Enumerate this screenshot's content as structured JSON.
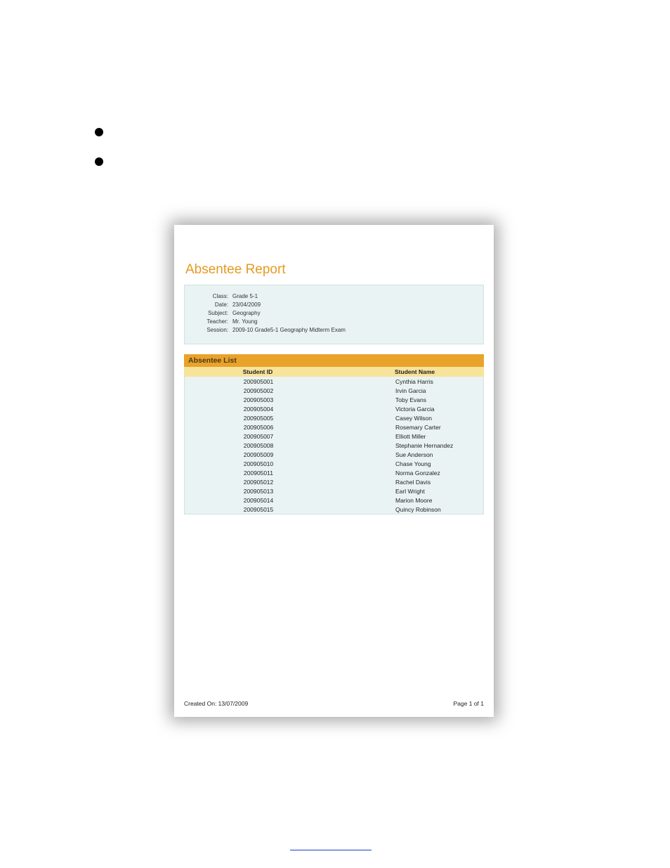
{
  "report": {
    "title": "Absentee Report",
    "info": {
      "class_label": "Class:",
      "class_value": "Grade 5-1",
      "date_label": "Date:",
      "date_value": "23/04/2009",
      "subject_label": "Subject:",
      "subject_value": "Geography",
      "teacher_label": "Teacher:",
      "teacher_value": "Mr. Young",
      "session_label": "Session:",
      "session_value": "2009-10 Grade5-1 Geography Midterm Exam"
    },
    "list_section_title": "Absentee List",
    "columns": {
      "id": "Student ID",
      "name": "Student Name"
    },
    "rows": [
      {
        "id": "200905001",
        "name": "Cynthia Harris"
      },
      {
        "id": "200905002",
        "name": "Irvin Garcia"
      },
      {
        "id": "200905003",
        "name": "Toby Evans"
      },
      {
        "id": "200905004",
        "name": "Victoria Garcia"
      },
      {
        "id": "200905005",
        "name": "Casey Wilson"
      },
      {
        "id": "200905006",
        "name": "Rosemary Carter"
      },
      {
        "id": "200905007",
        "name": "Elliott Miller"
      },
      {
        "id": "200905008",
        "name": "Stephanie Hernandez"
      },
      {
        "id": "200905009",
        "name": "Sue Anderson"
      },
      {
        "id": "200905010",
        "name": "Chase Young"
      },
      {
        "id": "200905011",
        "name": "Norma Gonzalez"
      },
      {
        "id": "200905012",
        "name": "Rachel Davis"
      },
      {
        "id": "200905013",
        "name": "Earl Wright"
      },
      {
        "id": "200905014",
        "name": "Marion Moore"
      },
      {
        "id": "200905015",
        "name": "Quincy Robinson"
      }
    ],
    "footer": {
      "created_on": "Created On: 13/07/2009",
      "page": "Page 1 of 1"
    }
  }
}
